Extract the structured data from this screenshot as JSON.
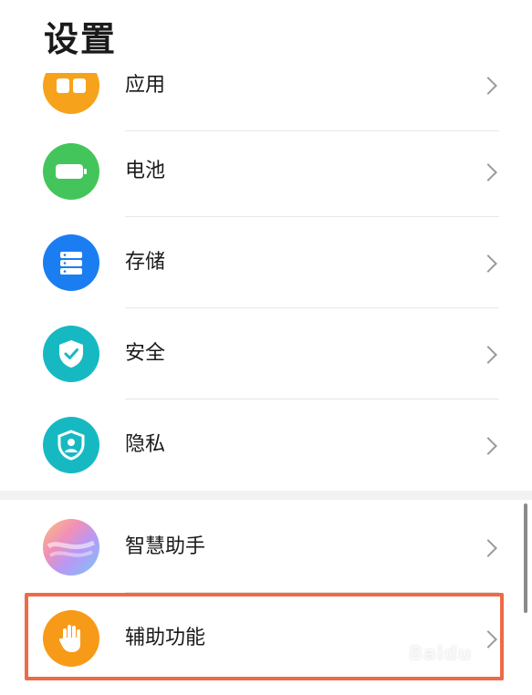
{
  "header": {
    "title": "设置"
  },
  "group1": {
    "items": [
      {
        "label": "应用",
        "icon": "apps-icon",
        "color": "#f7a21b"
      },
      {
        "label": "电池",
        "icon": "battery-icon",
        "color": "#43c55b"
      },
      {
        "label": "存储",
        "icon": "storage-icon",
        "color": "#1a7ef2"
      },
      {
        "label": "安全",
        "icon": "shield-check-icon",
        "color": "#16b9c2"
      },
      {
        "label": "隐私",
        "icon": "privacy-shield-icon",
        "color": "#16b9c2"
      }
    ]
  },
  "group2": {
    "items": [
      {
        "label": "智慧助手",
        "icon": "smart-assistant-icon",
        "color": "#c9a6f5"
      },
      {
        "label": "辅助功能",
        "icon": "hand-icon",
        "color": "#f79a17"
      }
    ]
  },
  "watermark": "Baidu"
}
